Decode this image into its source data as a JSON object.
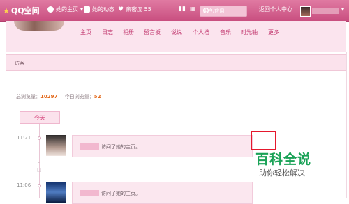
{
  "topbar": {
    "logo": "QQ空间",
    "items": [
      "她的主页",
      "她的动态",
      "亲密度 55"
    ],
    "search_placeholder": "用户/应用",
    "account_center": "返回个人中心"
  },
  "nav": [
    "主页",
    "日志",
    "相册",
    "留言板",
    "说说",
    "个人档",
    "音乐",
    "时光轴",
    "更多"
  ],
  "section": {
    "title": "访客"
  },
  "stats": {
    "total_label": "总浏览量：",
    "total_value": "10297",
    "today_label": "今日浏览量：",
    "today_value": "52"
  },
  "timeline": {
    "group_label": "今天",
    "entries": [
      {
        "time": "11:21",
        "action": "访问了她的主页。"
      },
      {
        "time": "11:06",
        "action": "访问了她的主页。"
      }
    ]
  },
  "watermark": {
    "main": "百科全说",
    "sub": "助你轻松解决"
  },
  "colors": {
    "brand": "#c94f80",
    "accent_orange": "#e36b1e",
    "highlight_red": "#e5182d",
    "watermark_green": "#1aa257"
  }
}
